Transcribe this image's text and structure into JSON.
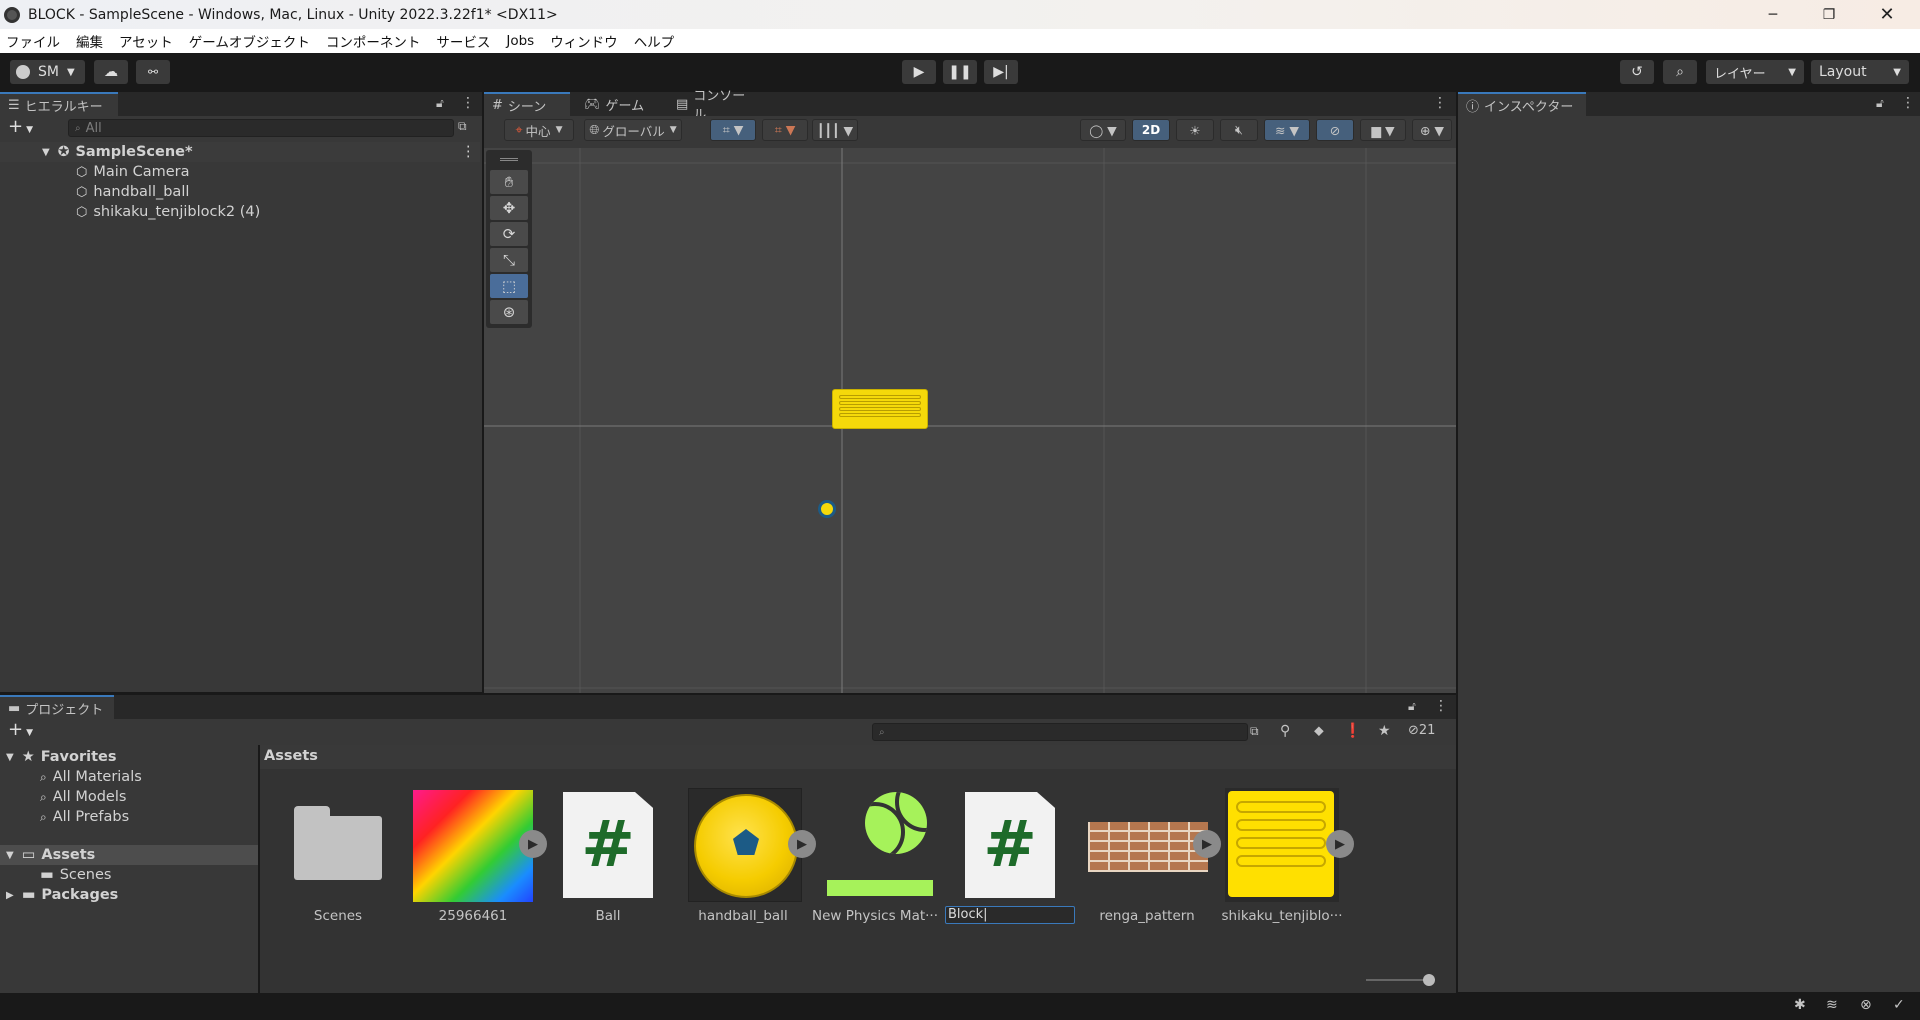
{
  "window": {
    "title": "BLOCK - SampleScene - Windows, Mac, Linux - Unity 2022.3.22f1* <DX11>"
  },
  "menu": [
    "ファイル",
    "編集",
    "アセット",
    "ゲームオブジェクト",
    "コンポーネント",
    "サービス",
    "Jobs",
    "ウィンドウ",
    "ヘルプ"
  ],
  "toolbar": {
    "account": "SM",
    "layers": "レイヤー",
    "layout": "Layout"
  },
  "hierarchy": {
    "tab": "ヒエラルキー",
    "search_placeholder": "All",
    "scene": "SampleScene*",
    "items": [
      "Main Camera",
      "handball_ball",
      "shikaku_tenjiblock2 (4)"
    ]
  },
  "scene_view": {
    "tabs": [
      "シーン",
      "ゲーム",
      "コンソール"
    ],
    "pivot": "中心",
    "space": "グローバル",
    "mode_2d": "2D"
  },
  "inspector": {
    "tab": "インスペクター"
  },
  "project": {
    "tab": "プロジェクト",
    "count": "21",
    "favorites": {
      "label": "Favorites",
      "items": [
        "All Materials",
        "All Models",
        "All Prefabs"
      ]
    },
    "assets_root": "Assets",
    "folders": [
      "Scenes"
    ],
    "packages": "Packages",
    "breadcrumb": "Assets",
    "assets": [
      {
        "name": "Scenes",
        "type": "folder"
      },
      {
        "name": "25966461",
        "type": "texture"
      },
      {
        "name": "Ball",
        "type": "script"
      },
      {
        "name": "handball_ball",
        "type": "model"
      },
      {
        "name": "New Physics Mat···",
        "type": "physics-material"
      },
      {
        "name": "Block|",
        "type": "script-renaming"
      },
      {
        "name": "renga_pattern",
        "type": "texture"
      },
      {
        "name": "shikaku_tenjiblo···",
        "type": "texture"
      }
    ]
  },
  "colors": {
    "accent": "#3a79bb",
    "yellow": "#f5d90a",
    "lime": "#a6f25a",
    "script_green": "#1e6b2a"
  }
}
